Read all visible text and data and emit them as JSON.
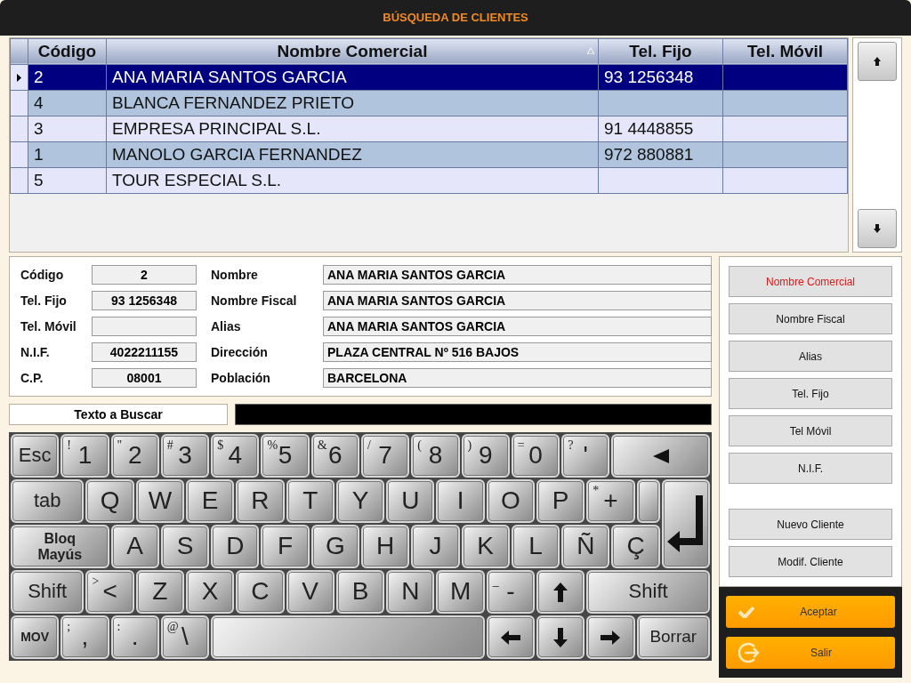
{
  "window": {
    "title": "BÚSQUEDA DE CLIENTES"
  },
  "table": {
    "columns": [
      {
        "label": "Código",
        "sorted": false
      },
      {
        "label": "Nombre Comercial",
        "sorted": true
      },
      {
        "label": "Tel. Fijo",
        "sorted": false
      },
      {
        "label": "Tel. Móvil",
        "sorted": false
      }
    ],
    "rows": [
      {
        "selected": true,
        "cells": [
          "2",
          "ANA MARIA SANTOS GARCIA",
          "93 1256348",
          null
        ]
      },
      {
        "selected": false,
        "cells": [
          "4",
          "BLANCA FERNANDEZ PRIETO",
          null,
          null
        ]
      },
      {
        "selected": false,
        "cells": [
          "3",
          "EMPRESA PRINCIPAL S.L.",
          "91 4448855",
          null
        ]
      },
      {
        "selected": false,
        "cells": [
          "1",
          "MANOLO GARCIA FERNANDEZ",
          "972 880881",
          null
        ]
      },
      {
        "selected": false,
        "cells": [
          "5",
          "TOUR ESPECIAL S.L.",
          null,
          null
        ]
      }
    ]
  },
  "details": {
    "left": [
      {
        "label": "Código",
        "value": "2"
      },
      {
        "label": "Tel. Fijo",
        "value": "93 1256348"
      },
      {
        "label": "Tel. Móvil"
      },
      {
        "label": "N.I.F.",
        "value": "4022211155"
      },
      {
        "label": "C.P.",
        "value": "08001"
      }
    ],
    "right": [
      {
        "label": "Nombre",
        "value": "ANA MARIA SANTOS GARCIA"
      },
      {
        "label": "Nombre Fiscal",
        "value": "ANA MARIA SANTOS GARCIA"
      },
      {
        "label": "Alias",
        "value": "ANA MARIA SANTOS GARCIA"
      },
      {
        "label": "Dirección",
        "value": "PLAZA CENTRAL Nº 516 BAJOS"
      },
      {
        "label": "Población",
        "value": "BARCELONA"
      }
    ]
  },
  "search": {
    "label": "Texto a Buscar"
  },
  "search_by": [
    {
      "label": "Nombre Comercial",
      "selected": true
    },
    {
      "label": "Nombre Fiscal",
      "selected": false
    },
    {
      "label": "Alias",
      "selected": false
    },
    {
      "label": "Tel. Fijo",
      "selected": false
    },
    {
      "label": "Tel Móvil",
      "selected": false
    },
    {
      "label": "N.I.F.",
      "selected": false
    }
  ],
  "actions": [
    "Nuevo Cliente",
    "Modif. Cliente"
  ],
  "dialog_buttons": [
    {
      "kind": "accept",
      "label": "Aceptar"
    },
    {
      "kind": "exit",
      "label": "Salir"
    }
  ],
  "keyboard": [
    [
      {
        "kind": "esc",
        "label": "Esc"
      },
      {
        "kind": "key",
        "label": "1",
        "shifted": "!"
      },
      {
        "kind": "key",
        "label": "2",
        "shifted": "\""
      },
      {
        "kind": "key",
        "label": "3",
        "shifted": "#"
      },
      {
        "kind": "key",
        "label": "4",
        "shifted": "$"
      },
      {
        "kind": "key",
        "label": "5",
        "shifted": "%"
      },
      {
        "kind": "key",
        "label": "6",
        "shifted": "&"
      },
      {
        "kind": "key",
        "label": "7",
        "shifted": "/"
      },
      {
        "kind": "key",
        "label": "8",
        "shifted": "("
      },
      {
        "kind": "key",
        "label": "9",
        "shifted": ")"
      },
      {
        "kind": "key",
        "label": "0",
        "shifted": "="
      },
      {
        "kind": "key",
        "label": "'",
        "shifted": "?"
      },
      {
        "kind": "back"
      }
    ],
    [
      {
        "kind": "tab",
        "label": "tab"
      },
      {
        "kind": "key",
        "label": "Q"
      },
      {
        "kind": "key",
        "label": "W"
      },
      {
        "kind": "key",
        "label": "E"
      },
      {
        "kind": "key",
        "label": "R"
      },
      {
        "kind": "key",
        "label": "T"
      },
      {
        "kind": "key",
        "label": "Y"
      },
      {
        "kind": "key",
        "label": "U"
      },
      {
        "kind": "key",
        "label": "I"
      },
      {
        "kind": "key",
        "label": "O"
      },
      {
        "kind": "key",
        "label": "P"
      },
      {
        "kind": "key",
        "label": "+",
        "shifted": "*"
      },
      {
        "kind": "blank"
      },
      {
        "kind": "enter"
      }
    ],
    [
      {
        "kind": "caps",
        "label": "Bloq Mayús"
      },
      {
        "kind": "key",
        "label": "A"
      },
      {
        "kind": "key",
        "label": "S"
      },
      {
        "kind": "key",
        "label": "D"
      },
      {
        "kind": "key",
        "label": "F"
      },
      {
        "kind": "key",
        "label": "G"
      },
      {
        "kind": "key",
        "label": "H"
      },
      {
        "kind": "key",
        "label": "J"
      },
      {
        "kind": "key",
        "label": "K"
      },
      {
        "kind": "key",
        "label": "L"
      },
      {
        "kind": "key",
        "label": "Ñ"
      },
      {
        "kind": "key",
        "label": "Ç"
      }
    ],
    [
      {
        "kind": "lshift",
        "label": "Shift"
      },
      {
        "kind": "key",
        "label": "<",
        "shifted": ">"
      },
      {
        "kind": "key",
        "label": "Z"
      },
      {
        "kind": "key",
        "label": "X"
      },
      {
        "kind": "key",
        "label": "C"
      },
      {
        "kind": "key",
        "label": "V"
      },
      {
        "kind": "key",
        "label": "B"
      },
      {
        "kind": "key",
        "label": "N"
      },
      {
        "kind": "key",
        "label": "M"
      },
      {
        "kind": "key",
        "label": "-",
        "shifted": "_"
      },
      {
        "kind": "up"
      },
      {
        "kind": "rshift",
        "label": "Shift"
      }
    ],
    [
      {
        "kind": "mov",
        "label": "MOV"
      },
      {
        "kind": "key",
        "label": ",",
        "shifted": ";"
      },
      {
        "kind": "key",
        "label": ".",
        "shifted": ":"
      },
      {
        "kind": "key",
        "label": "\\",
        "shifted": "@"
      },
      {
        "kind": "space"
      },
      {
        "kind": "left"
      },
      {
        "kind": "down"
      },
      {
        "kind": "right"
      },
      {
        "kind": "erase",
        "label": "Borrar"
      }
    ]
  ]
}
